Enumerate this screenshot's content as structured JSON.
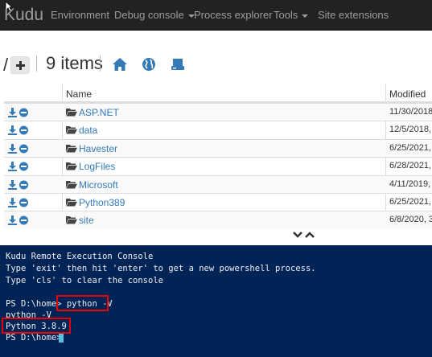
{
  "navbar": {
    "brand": "Kudu",
    "items": [
      {
        "label": "Environment"
      },
      {
        "label": "Debug console"
      },
      {
        "label": "Process explorer"
      },
      {
        "label": "Tools"
      },
      {
        "label": "Site extensions"
      }
    ]
  },
  "toolbar": {
    "path": "/",
    "item_count": "9 items",
    "icons": [
      "plus-icon",
      "home-icon",
      "globe-icon",
      "drive-icon"
    ]
  },
  "table": {
    "headers": [
      "Name",
      "Modified"
    ],
    "rows": [
      {
        "name": "ASP.NET",
        "modified": "11/30/2018,"
      },
      {
        "name": "data",
        "modified": "12/5/2018, 2"
      },
      {
        "name": "Havester",
        "modified": "6/25/2021, 1"
      },
      {
        "name": "LogFiles",
        "modified": "6/28/2021, 1"
      },
      {
        "name": "Microsoft",
        "modified": "4/11/2019, 1"
      },
      {
        "name": "Python389",
        "modified": "6/25/2021, 1"
      },
      {
        "name": "site",
        "modified": "6/8/2020, 3:"
      }
    ]
  },
  "console": {
    "lines": [
      "Kudu Remote Execution Console",
      "Type 'exit' then hit 'enter' to get a new powershell process.",
      "Type 'cls' to clear the console",
      "",
      "PS D:\\home> python -V",
      "python -V",
      "Python 3.8.9",
      "PS D:\\home> "
    ]
  },
  "colors": {
    "navbar_bg": "#222222",
    "link": "#337ab7",
    "console_bg": "#012456",
    "highlight": "#e60000"
  }
}
